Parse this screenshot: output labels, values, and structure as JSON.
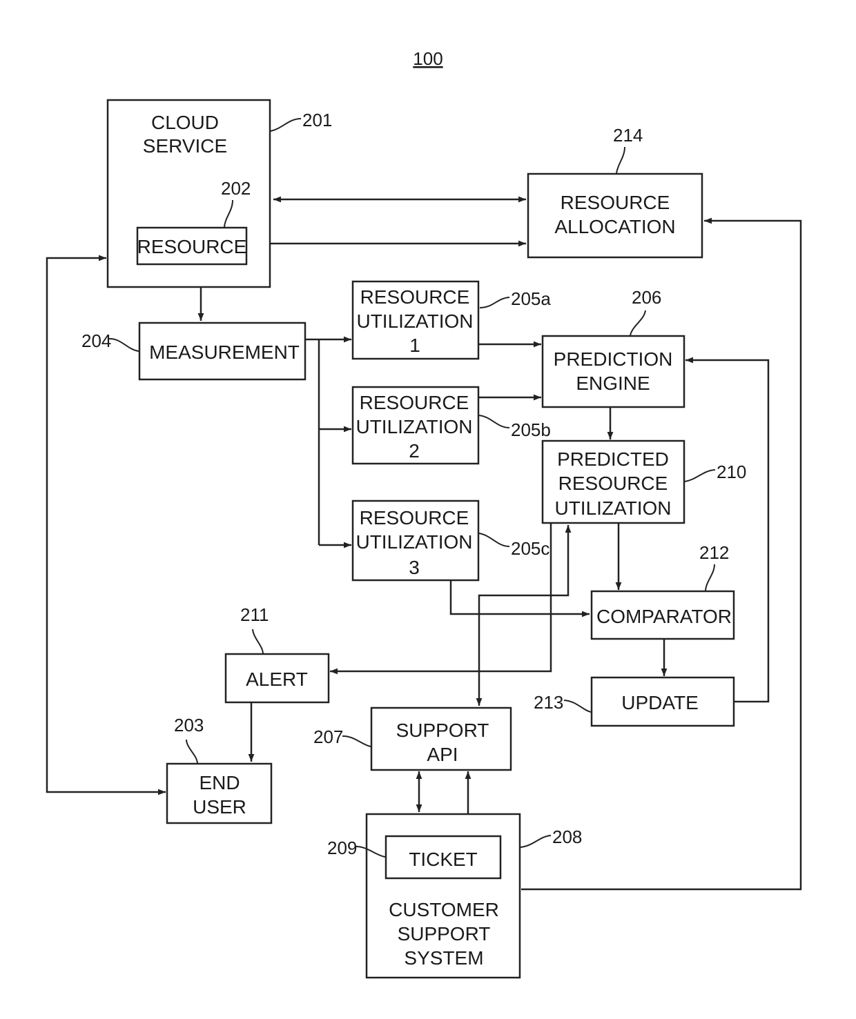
{
  "figure": {
    "number": "100",
    "colors": {
      "ink": "#222222",
      "background": "#ffffff"
    }
  },
  "nodes": {
    "cloud_service": {
      "ref": "201",
      "lines": [
        "CLOUD",
        "SERVICE"
      ]
    },
    "resource": {
      "ref": "202",
      "lines": [
        "RESOURCE"
      ]
    },
    "end_user": {
      "ref": "203",
      "lines": [
        "END",
        "USER"
      ]
    },
    "measurement": {
      "ref": "204",
      "lines": [
        "MEASUREMENT"
      ]
    },
    "resource_utilization_1": {
      "ref": "205a",
      "lines": [
        "RESOURCE",
        "UTILIZATION",
        "1"
      ]
    },
    "resource_utilization_2": {
      "ref": "205b",
      "lines": [
        "RESOURCE",
        "UTILIZATION",
        "2"
      ]
    },
    "resource_utilization_3": {
      "ref": "205c",
      "lines": [
        "RESOURCE",
        "UTILIZATION",
        "3"
      ]
    },
    "prediction_engine": {
      "ref": "206",
      "lines": [
        "PREDICTION",
        "ENGINE"
      ]
    },
    "support_api": {
      "ref": "207",
      "lines": [
        "SUPPORT",
        "API"
      ]
    },
    "customer_support_system": {
      "ref": "208",
      "lines": [
        "CUSTOMER",
        "SUPPORT",
        "SYSTEM"
      ]
    },
    "ticket": {
      "ref": "209",
      "lines": [
        "TICKET"
      ]
    },
    "predicted_resource_utilization": {
      "ref": "210",
      "lines": [
        "PREDICTED",
        "RESOURCE",
        "UTILIZATION"
      ]
    },
    "alert": {
      "ref": "211",
      "lines": [
        "ALERT"
      ]
    },
    "comparator": {
      "ref": "212",
      "lines": [
        "COMPARATOR"
      ]
    },
    "update": {
      "ref": "213",
      "lines": [
        "UPDATE"
      ]
    },
    "resource_allocation": {
      "ref": "214",
      "lines": [
        "RESOURCE",
        "ALLOCATION"
      ]
    }
  },
  "edges": [
    {
      "from": "cloud_service",
      "to": "resource_allocation",
      "direction": "both"
    },
    {
      "from": "resource",
      "to": "resource_allocation",
      "direction": "both"
    },
    {
      "from": "resource",
      "to": "measurement",
      "direction": "both"
    },
    {
      "from": "end_user",
      "to": "cloud_service",
      "direction": "both"
    },
    {
      "from": "measurement",
      "to": "resource_utilization_1",
      "direction": "forward"
    },
    {
      "from": "measurement",
      "to": "resource_utilization_2",
      "direction": "forward"
    },
    {
      "from": "measurement",
      "to": "resource_utilization_3",
      "direction": "forward"
    },
    {
      "from": "resource_utilization_1",
      "to": "prediction_engine",
      "direction": "forward"
    },
    {
      "from": "resource_utilization_2",
      "to": "prediction_engine",
      "direction": "forward"
    },
    {
      "from": "prediction_engine",
      "to": "predicted_resource_utilization",
      "direction": "forward"
    },
    {
      "from": "predicted_resource_utilization",
      "to": "comparator",
      "direction": "forward"
    },
    {
      "from": "resource_utilization_3",
      "to": "comparator",
      "direction": "forward"
    },
    {
      "from": "predicted_resource_utilization",
      "to": "alert",
      "direction": "forward"
    },
    {
      "from": "support_api",
      "to": "predicted_resource_utilization",
      "direction": "both"
    },
    {
      "from": "comparator",
      "to": "update",
      "direction": "forward"
    },
    {
      "from": "update",
      "to": "prediction_engine",
      "direction": "forward"
    },
    {
      "from": "alert",
      "to": "end_user",
      "direction": "forward"
    },
    {
      "from": "support_api",
      "to": "customer_support_system",
      "direction": "both"
    },
    {
      "from": "support_api",
      "to": "ticket",
      "direction": "both"
    },
    {
      "from": "customer_support_system",
      "to": "resource_allocation",
      "direction": "forward"
    }
  ]
}
